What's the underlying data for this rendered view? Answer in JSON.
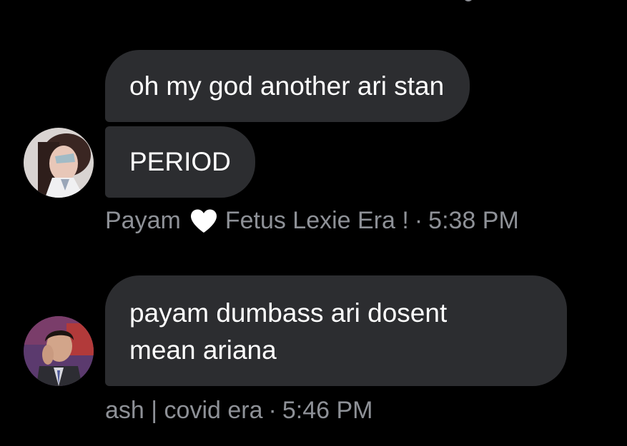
{
  "messages": [
    {
      "group": "payam",
      "bubbles": [
        {
          "text": "oh my god another ari stan"
        },
        {
          "text": "PERIOD"
        }
      ],
      "meta": {
        "sender_prefix": "Payam",
        "heart_icon": "heart-icon",
        "sender_suffix": "Fetus Lexie Era !",
        "separator": "·",
        "time": "5:38 PM"
      }
    },
    {
      "group": "ash",
      "bubbles": [
        {
          "line1": "payam dumbass ari dosent",
          "line2": "mean ariana"
        }
      ],
      "meta": {
        "sender": "ash | covid era",
        "separator": "·",
        "time": "5:46 PM"
      }
    }
  ],
  "colors": {
    "background": "#000000",
    "bubble": "#2c2d30",
    "text": "#ffffff",
    "meta_text": "#8e9197"
  }
}
